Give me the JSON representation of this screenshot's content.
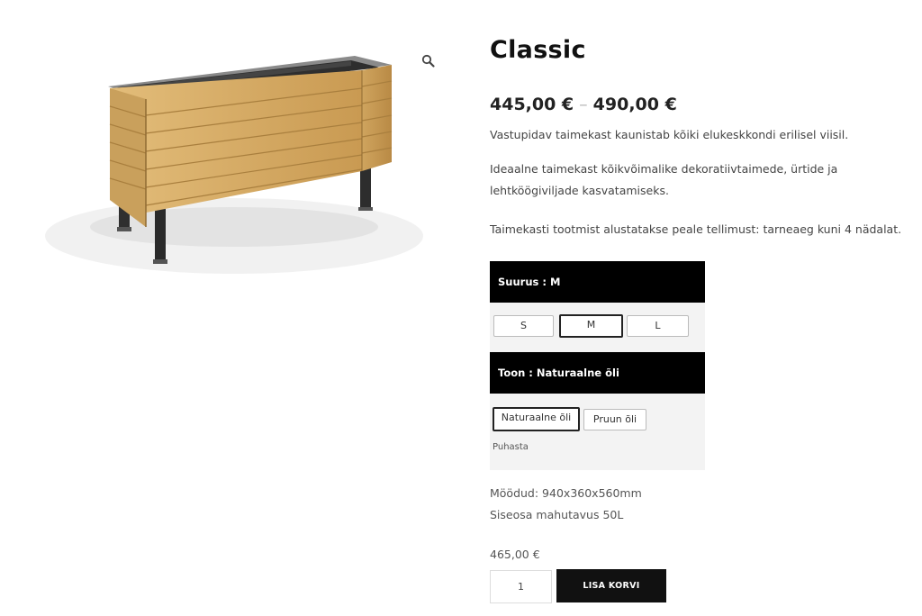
{
  "product": {
    "title": "Classic",
    "price_min": "445,00 €",
    "price_sep": "–",
    "price_max": "490,00 €",
    "description": [
      "Vastupidav taimekast kaunistab kõiki elukeskkondi erilisel viisil.",
      "Ideaalne taimekast kõikvõimalike dekoratiivtaimede, ürtide ja",
      "lehtköögiviljade kasvatamiseks.",
      "Taimekasti tootmist alustatakse peale tellimust: tarneaeg kuni 4 nädalat."
    ]
  },
  "variations": {
    "size_header": "Suurus : M",
    "size_options": [
      "S",
      "M",
      "L"
    ],
    "size_selected": "M",
    "color_header": "Toon : Naturaalne õli",
    "color_options": [
      "Naturaalne õli",
      "Pruun õli"
    ],
    "color_selected": "Naturaalne õli",
    "clear_label": "Puhasta"
  },
  "details": {
    "dimensions": "Möödud: 940x360x560mm",
    "capacity": "Siseosa mahutavus 50L"
  },
  "cart": {
    "variation_price": "465,00 €",
    "quantity": "1",
    "add_label": "LISA KORVI"
  },
  "icons": {
    "zoom": "magnifier-icon"
  },
  "colors": {
    "header_bg": "#000000",
    "panel_bg": "#f3f3f3",
    "button_bg": "#111111",
    "wood": "#d9b26a",
    "metal": "#3a3a3a"
  }
}
